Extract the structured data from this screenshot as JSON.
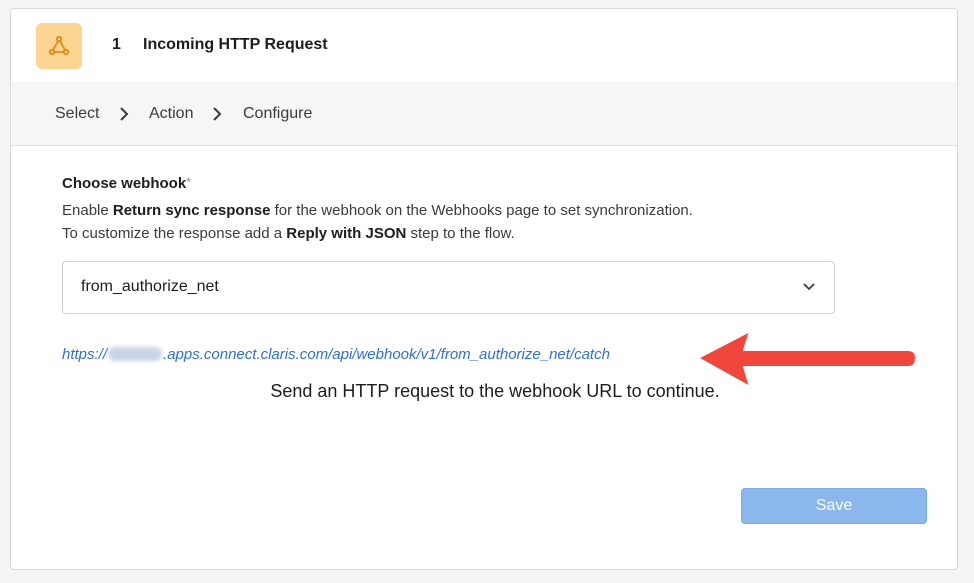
{
  "step": {
    "number": "1",
    "title": "Incoming HTTP Request",
    "icon": "webhook-icon",
    "icon_bg": "#fbd591"
  },
  "breadcrumb": {
    "items": [
      "Select",
      "Action",
      "Configure"
    ]
  },
  "form": {
    "label": "Choose webhook",
    "required_mark": "*",
    "help1_pre": "Enable ",
    "help1_bold": "Return sync response",
    "help1_post": " for the webhook on the Webhooks page to set synchronization.",
    "help2_pre": "To customize the response add a ",
    "help2_bold": "Reply with JSON",
    "help2_post": " step to the flow.",
    "selected_value": "from_authorize_net"
  },
  "webhook_url": {
    "prefix": "https://",
    "suffix": ".apps.connect.claris.com/api/webhook/v1/from_authorize_net/catch",
    "link_color": "#2f6fd6"
  },
  "info_text": "Send an HTTP request to the webhook URL to continue.",
  "save_label": "Save",
  "colors": {
    "annotation_arrow": "#f0463c",
    "save_button": "#8cb7ec"
  }
}
